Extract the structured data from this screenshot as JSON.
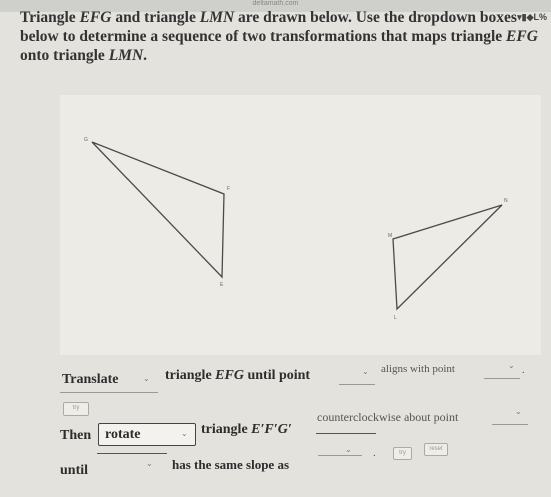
{
  "browser": {
    "url": "deltamath.com",
    "status_icons": "▾▮◆L%"
  },
  "prompt": {
    "line1_a": "Triangle ",
    "t1": "EFG",
    "line1_b": " and triangle ",
    "t2": "LMN",
    "line1_c": " are drawn below. Use the dropdown boxes",
    "line2_a": "below to determine a sequence of two transformations that maps triangle ",
    "t3": "EFG",
    "line3_a": "onto triangle ",
    "t4": "LMN",
    "line3_b": "."
  },
  "figure": {
    "vertices": {
      "G": "G",
      "F": "F",
      "E": "E",
      "N": "N",
      "M": "M",
      "L": "L"
    }
  },
  "step1": {
    "action_value": "Translate",
    "text_a": "triangle ",
    "tri": "EFG",
    "text_b": " until point",
    "point1_value": "",
    "text_c": "aligns with point",
    "point2_value": "",
    "end": "."
  },
  "try_button": "try",
  "step2": {
    "then": "Then",
    "action_value": "rotate",
    "text_a": "triangle ",
    "tri": "E′F′G′",
    "direction": "counterclockwise about point",
    "point_value": ""
  },
  "step3": {
    "until": "until",
    "segment_value": "",
    "text": "has the same slope as",
    "segment2_value": "",
    "end": ".",
    "try_button": "try",
    "reset_button": "reset"
  }
}
